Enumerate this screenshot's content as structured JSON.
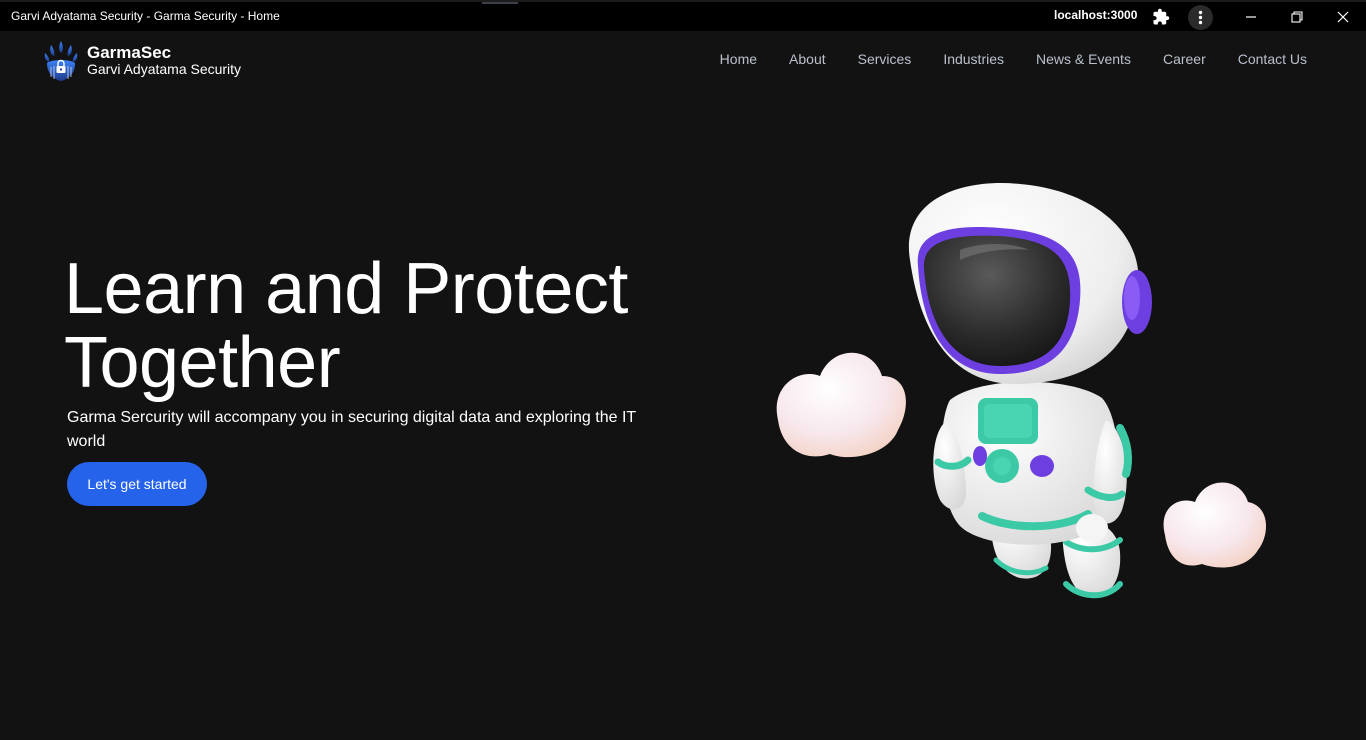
{
  "window": {
    "title": "Garvi Adyatama Security - Garma Security - Home",
    "url": "localhost:3000"
  },
  "brand": {
    "name": "GarmaSec",
    "subtitle": "Garvi Adyatama Security"
  },
  "nav": {
    "items": [
      {
        "label": "Home"
      },
      {
        "label": "About"
      },
      {
        "label": "Services"
      },
      {
        "label": "Industries"
      },
      {
        "label": "News & Events"
      },
      {
        "label": "Career"
      },
      {
        "label": "Contact Us"
      }
    ]
  },
  "hero": {
    "title_line1": "Learn and Protect",
    "title_line2": "Together",
    "subtitle": "Garma Sercurity will accompany you in securing digital data and exploring the IT world",
    "cta_label": "Let's get started"
  },
  "colors": {
    "background": "#121212",
    "accent": "#2563eb",
    "nav_text": "#b9c0cc",
    "astronaut_visor_ring": "#6d3fe0",
    "astronaut_trim": "#3cc9a6"
  },
  "icons": {
    "extensions": "puzzle-icon",
    "menu": "more-vertical-icon",
    "minimize": "minimize-icon",
    "maximize": "restore-icon",
    "close": "close-icon",
    "logo": "garmasec-logo"
  }
}
